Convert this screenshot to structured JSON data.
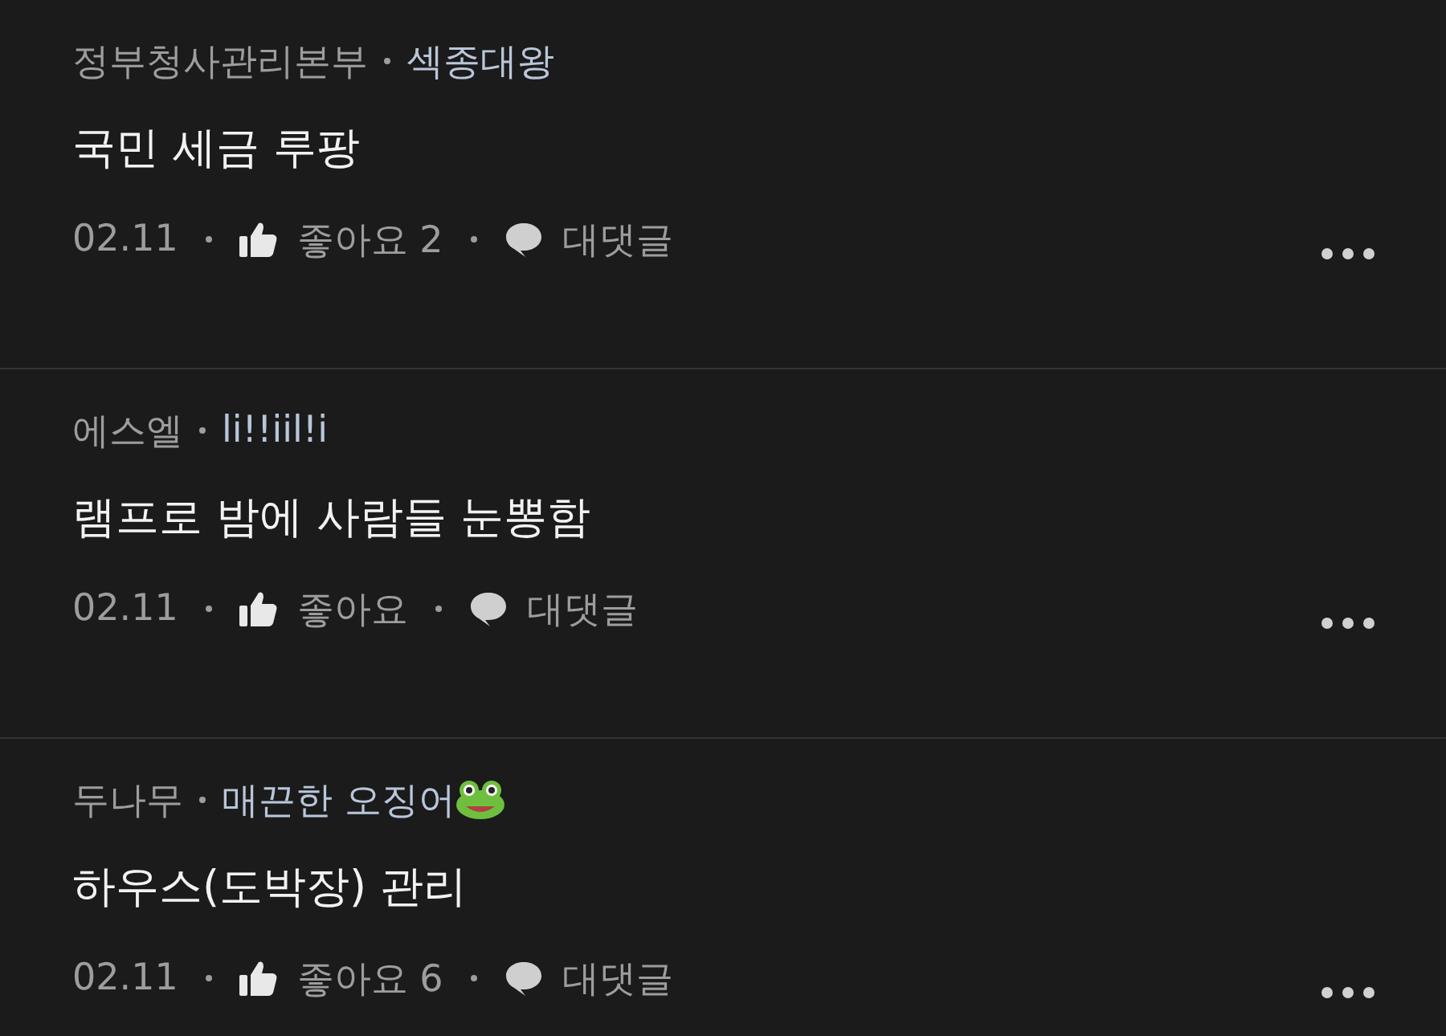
{
  "comments": [
    {
      "author": "정부청사관리본부",
      "nickname": "섹종대왕",
      "text": "국민 세금 루팡",
      "date": "02.11",
      "likes": "좋아요 2",
      "reply": "대댓글"
    },
    {
      "author": "에스엘",
      "nickname": "li!!iil!i",
      "text": "램프로 밤에 사람들 눈뽕함",
      "date": "02.11",
      "likes": "좋아요",
      "reply": "대댓글"
    },
    {
      "author": "두나무",
      "nickname": "매끈한 오징어",
      "frog_badge": true,
      "text": "하우스(도박장) 관리",
      "date": "02.11",
      "likes": "좋아요 6",
      "reply": "대댓글"
    }
  ]
}
